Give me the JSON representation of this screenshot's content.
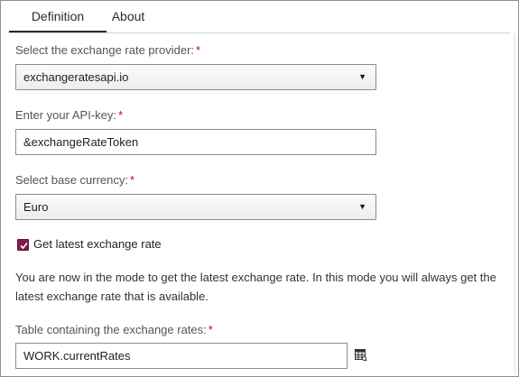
{
  "tabs": [
    {
      "label": "Definition",
      "active": true
    },
    {
      "label": "About",
      "active": false
    }
  ],
  "fields": {
    "provider": {
      "label": "Select the exchange rate provider:",
      "required_mark": "*",
      "value": "exchangeratesapi.io"
    },
    "api_key": {
      "label": "Enter your API-key:",
      "required_mark": "*",
      "value": "&exchangeRateToken"
    },
    "base_currency": {
      "label": "Select base currency:",
      "required_mark": "*",
      "value": "Euro"
    },
    "latest_checkbox": {
      "label": "Get latest exchange rate",
      "checked": true
    },
    "info_text": "You are now in the mode to get the latest exchange rate. In this mode you will always get the latest exchange rate that is available.",
    "table": {
      "label": "Table containing the exchange rates:",
      "required_mark": "*",
      "value": "WORK.currentRates"
    }
  },
  "icons": {
    "dropdown": "caret-down-icon",
    "checkbox_check": "check-icon",
    "table_browse": "table-browse-icon"
  },
  "colors": {
    "accent": "#7c1e4f",
    "required": "#d1011a",
    "label": "#545454"
  }
}
